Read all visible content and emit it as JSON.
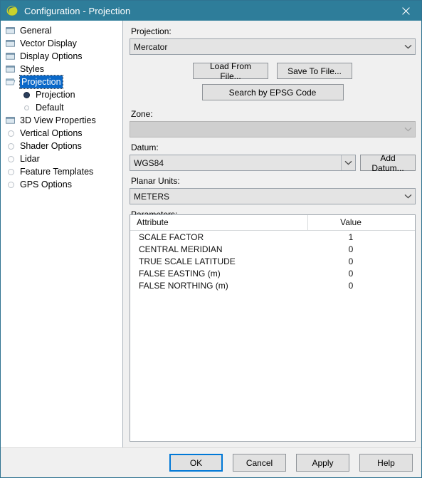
{
  "window": {
    "title": "Configuration - Projection",
    "icon": "globe-icon",
    "close_label": "✕"
  },
  "sidebar": {
    "items": [
      {
        "label": "General",
        "icon": "folder-icon",
        "level": 0,
        "selected": false
      },
      {
        "label": "Vector Display",
        "icon": "folder-icon",
        "level": 0,
        "selected": false
      },
      {
        "label": "Display Options",
        "icon": "folder-icon",
        "level": 0,
        "selected": false
      },
      {
        "label": "Styles",
        "icon": "folder-icon",
        "level": 0,
        "selected": false
      },
      {
        "label": "Projection",
        "icon": "folder-open-icon",
        "level": 0,
        "selected": true
      },
      {
        "label": "Projection",
        "icon": "radio-selected-icon",
        "level": 1,
        "selected": false
      },
      {
        "label": "Default",
        "icon": "radio-unselected-icon",
        "level": 1,
        "selected": false
      },
      {
        "label": "3D View Properties",
        "icon": "folder-icon",
        "level": 0,
        "selected": false
      },
      {
        "label": "Vertical Options",
        "icon": "circle-icon",
        "level": 0,
        "selected": false
      },
      {
        "label": "Shader Options",
        "icon": "circle-icon",
        "level": 0,
        "selected": false
      },
      {
        "label": "Lidar",
        "icon": "circle-icon",
        "level": 0,
        "selected": false
      },
      {
        "label": "Feature Templates",
        "icon": "circle-icon",
        "level": 0,
        "selected": false
      },
      {
        "label": "GPS Options",
        "icon": "circle-icon",
        "level": 0,
        "selected": false
      }
    ]
  },
  "main": {
    "projection": {
      "label": "Projection:",
      "value": "Mercator"
    },
    "load_from_file_label": "Load From File...",
    "save_to_file_label": "Save To File...",
    "search_epsg_label": "Search by EPSG Code",
    "zone": {
      "label": "Zone:",
      "value": "",
      "disabled": true
    },
    "datum": {
      "label": "Datum:",
      "value": "WGS84"
    },
    "add_datum_label": "Add Datum...",
    "planar_units": {
      "label": "Planar Units:",
      "value": "METERS"
    },
    "parameters": {
      "label": "Parameters:",
      "columns": [
        "Attribute",
        "Value"
      ],
      "rows": [
        {
          "attribute": "SCALE FACTOR",
          "value": "1"
        },
        {
          "attribute": "CENTRAL MERIDIAN",
          "value": "0"
        },
        {
          "attribute": "TRUE SCALE LATITUDE",
          "value": "0"
        },
        {
          "attribute": "FALSE EASTING (m)",
          "value": "0"
        },
        {
          "attribute": "FALSE NORTHING (m)",
          "value": "0"
        }
      ]
    }
  },
  "footer": {
    "ok_label": "OK",
    "cancel_label": "Cancel",
    "apply_label": "Apply",
    "help_label": "Help"
  },
  "colors": {
    "titlebar": "#2e7d9a",
    "accent": "#0078d7",
    "selection": "#0a68c8"
  }
}
